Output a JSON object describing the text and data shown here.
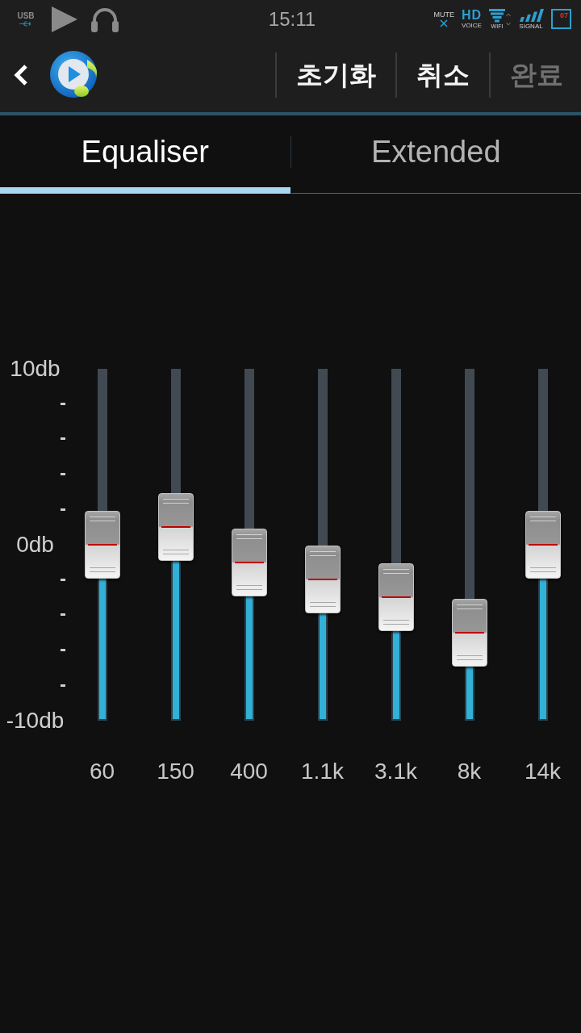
{
  "status_bar": {
    "left": [
      {
        "kind": "usb",
        "label": "USB"
      },
      {
        "kind": "play"
      },
      {
        "kind": "headphones"
      }
    ],
    "time": "15:11",
    "right": [
      {
        "kind": "mute",
        "label": "MUTE"
      },
      {
        "kind": "hd_voice",
        "label": "HD",
        "sublabel": "VOICE"
      },
      {
        "kind": "wifi",
        "label": "WIFI"
      },
      {
        "kind": "signal",
        "label": "SIGNAL"
      },
      {
        "kind": "battery",
        "label": "07"
      }
    ]
  },
  "header": {
    "actions": [
      {
        "label": "초기화",
        "disabled": false
      },
      {
        "label": "취소",
        "disabled": false
      },
      {
        "label": "완료",
        "disabled": true
      }
    ]
  },
  "tabs": [
    {
      "label": "Equaliser",
      "selected": true
    },
    {
      "label": "Extended",
      "selected": false
    }
  ],
  "equalizer": {
    "scale": [
      "10db",
      "0db",
      "-10db"
    ],
    "bands": [
      {
        "label": "60",
        "level": 0.5
      },
      {
        "label": "150",
        "level": 0.55
      },
      {
        "label": "400",
        "level": 0.45
      },
      {
        "label": "1.1k",
        "level": 0.4
      },
      {
        "label": "3.1k",
        "level": 0.35
      },
      {
        "label": "8k",
        "level": 0.25
      },
      {
        "label": "14k",
        "level": 0.5
      }
    ]
  }
}
